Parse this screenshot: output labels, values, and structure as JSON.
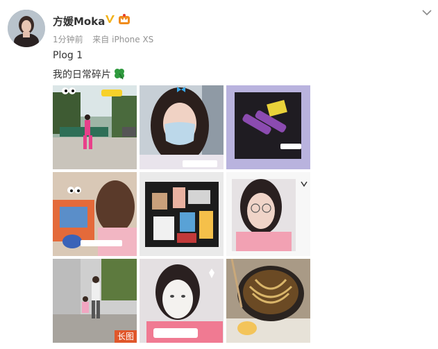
{
  "post": {
    "username": "方媛Moka",
    "time": "1分钟前",
    "source_prefix": "来自",
    "source": "iPhone XS",
    "text_line1": "Plog 1",
    "text_line2": "我的日常碎片"
  },
  "icons": {
    "verified": "verified-v-icon",
    "member": "crown-member-icon",
    "more": "chevron-down-icon",
    "clover": "four-leaf-clover-icon"
  },
  "colors": {
    "verified": "#f2b21a",
    "member": "#f08c1d",
    "long_image_tag": "#e0572b",
    "meta_text": "#939393"
  },
  "photos": [
    {
      "description": "girl-in-pink-on-street",
      "stickers": "嘻嘻饿点"
    },
    {
      "description": "selfie-with-mask-and-butterflies",
      "stickers": "出门戴口罩"
    },
    {
      "description": "purple-dumbbells-and-yellow-cloth",
      "stickers": "运动ing"
    },
    {
      "description": "girl-with-toys",
      "stickers": "今天也在陪伴她"
    },
    {
      "description": "open-suitcase-with-items",
      "stickers": ""
    },
    {
      "description": "portrait-with-glasses",
      "stickers": ""
    },
    {
      "description": "mother-and-daughter-walking",
      "stickers": "",
      "tag": "长图"
    },
    {
      "description": "face-mask-selfie",
      "stickers": "认真护肤"
    },
    {
      "description": "bowl-of-noodles",
      "stickers": ""
    }
  ]
}
